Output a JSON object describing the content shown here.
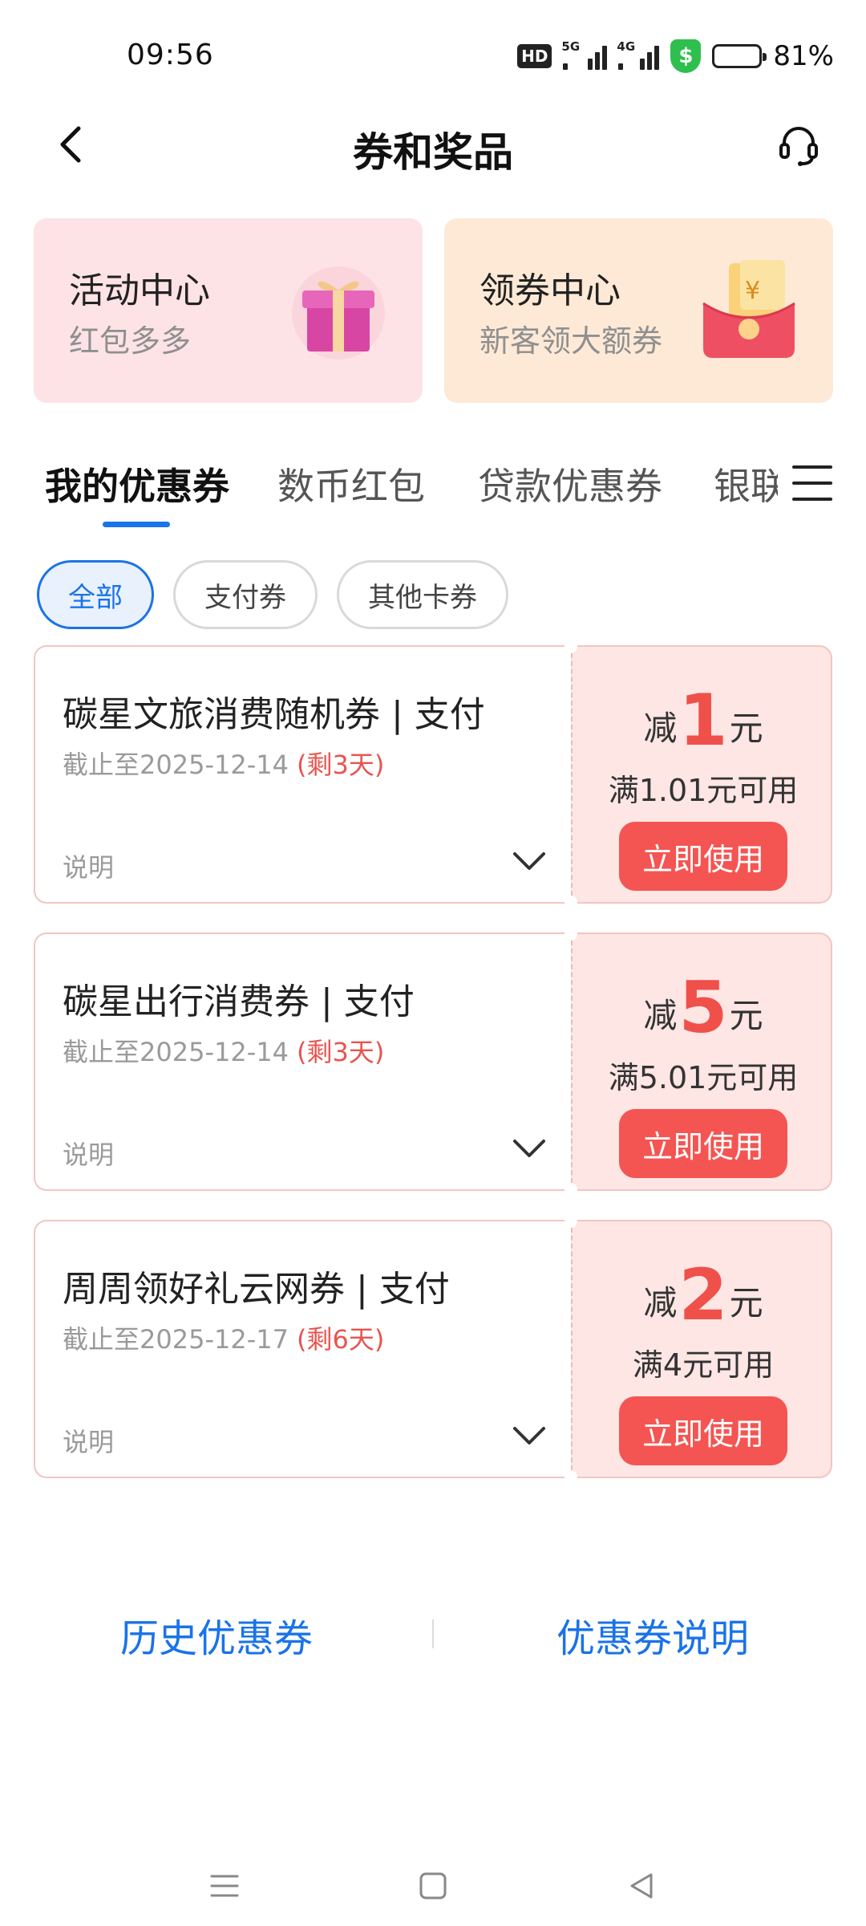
{
  "status_bar": {
    "time": "09:56",
    "hd_label": "HD",
    "signal_1_label": "5G",
    "signal_2_label": "4G",
    "shield_symbol": "$",
    "battery_level": 0.81,
    "battery_text": "81%"
  },
  "header": {
    "title": "券和奖品",
    "back_icon": "back-arrow",
    "service_icon": "headset"
  },
  "promos": [
    {
      "title": "活动中心",
      "subtitle": "红包多多",
      "icon": "gift-box",
      "color": "#fde3e6"
    },
    {
      "title": "领券中心",
      "subtitle": "新客领大额券",
      "icon": "red-envelope",
      "color": "#fde9d6"
    }
  ],
  "tabs": {
    "items": [
      "我的优惠券",
      "数币红包",
      "贷款优惠券",
      "银联"
    ],
    "active_index": 0
  },
  "chips": {
    "items": [
      "全部",
      "支付券",
      "其他卡券"
    ],
    "active_index": 0
  },
  "coupons": [
    {
      "name": "碳星文旅消费随机券 | 支付",
      "expiry": "截止至2025-12-14",
      "remaining": "(剩3天)",
      "explain_label": "说明",
      "reduce_prefix": "减",
      "amount": "1",
      "unit": "元",
      "condition": "满1.01元可用",
      "button": "立即使用"
    },
    {
      "name": "碳星出行消费券 | 支付",
      "expiry": "截止至2025-12-14",
      "remaining": "(剩3天)",
      "explain_label": "说明",
      "reduce_prefix": "减",
      "amount": "5",
      "unit": "元",
      "condition": "满5.01元可用",
      "button": "立即使用"
    },
    {
      "name": "周周领好礼云网券 | 支付",
      "expiry": "截止至2025-12-17",
      "remaining": "(剩6天)",
      "explain_label": "说明",
      "reduce_prefix": "减",
      "amount": "2",
      "unit": "元",
      "condition": "满4元可用",
      "button": "立即使用"
    }
  ],
  "footer": {
    "history_link": "历史优惠券",
    "explain_link": "优惠券说明"
  },
  "colors": {
    "accent_blue": "#1a73e8",
    "coupon_red": "#f45552",
    "coupon_bg": "#fde6e4"
  }
}
